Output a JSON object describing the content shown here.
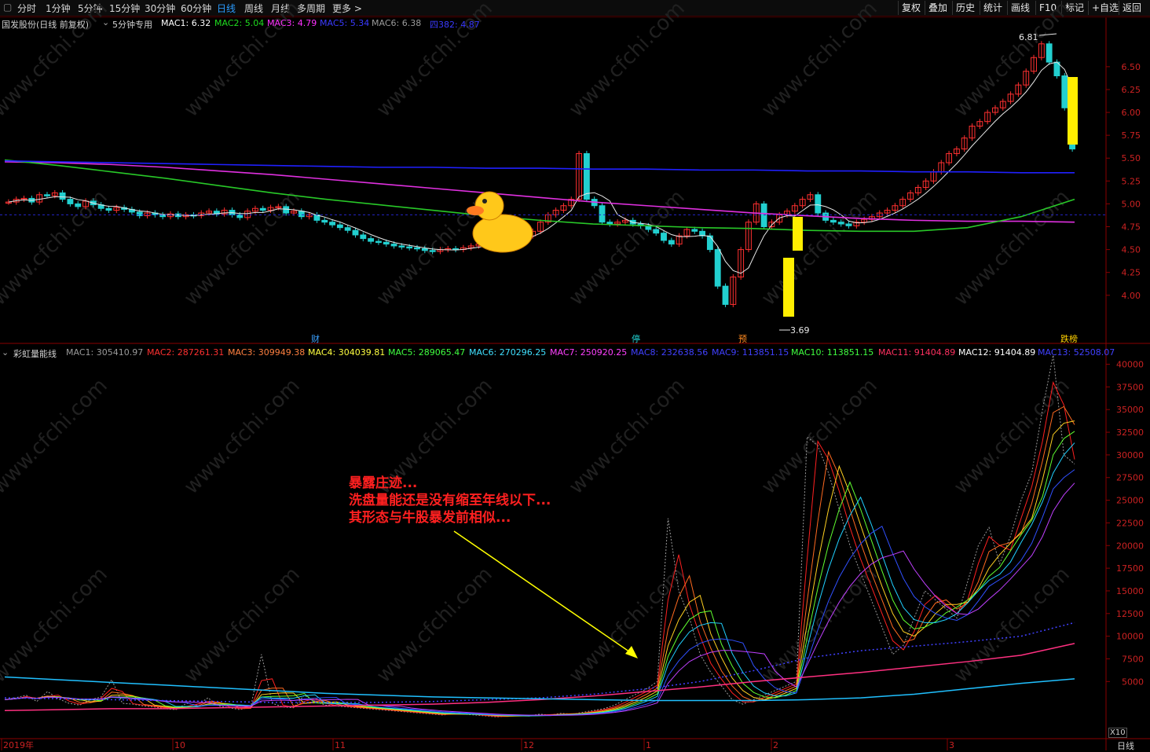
{
  "toolbar": {
    "tabs": [
      "分时",
      "1分钟",
      "5分钟",
      "15分钟",
      "30分钟",
      "60分钟",
      "日线",
      "周线",
      "月线",
      "多周期",
      "更多 >"
    ],
    "active_tab": "日线",
    "right_buttons": [
      "复权",
      "叠加",
      "历史",
      "统计",
      "画线",
      "F10",
      "标记",
      "+自选",
      "返回"
    ]
  },
  "price_panel": {
    "title": "国发股份(日线 前复权)",
    "indicator": "5分钟专用",
    "legend": [
      {
        "label": "MAC1: 6.32",
        "color": "#ffffff"
      },
      {
        "label": "MAC2: 5.04",
        "color": "#1fdc1f"
      },
      {
        "label": "MAC3: 4.79",
        "color": "#ff30ff"
      },
      {
        "label": "MAC5: 5.34",
        "color": "#3a3aff"
      },
      {
        "label": "MAC6: 6.38",
        "color": "#9a9a9a"
      },
      {
        "label": "四382: 4.87",
        "color": "#3a3aff"
      }
    ],
    "high_label": "6.81",
    "low_label": "3.69",
    "markers": [
      {
        "text": "财",
        "color": "#3aa0ff"
      },
      {
        "text": "停",
        "color": "#22d4d4"
      },
      {
        "text": "预",
        "color": "#ff8a20"
      },
      {
        "text": "跌榜",
        "color": "#ffd000"
      }
    ]
  },
  "volume_panel": {
    "title": "彩虹量能线",
    "legend": [
      {
        "label": "MAC1: 305410.97",
        "color": "#9a9a9a"
      },
      {
        "label": "MAC2: 287261.31",
        "color": "#ff3030"
      },
      {
        "label": "MAC3: 309949.38",
        "color": "#ff8040"
      },
      {
        "label": "MAC4: 304039.81",
        "color": "#ffff40"
      },
      {
        "label": "MAC5: 289065.47",
        "color": "#40ff40"
      },
      {
        "label": "MAC6: 270296.25",
        "color": "#40e0ff"
      },
      {
        "label": "MAC7: 250920.25",
        "color": "#ff40ff"
      },
      {
        "label": "MAC8: 232638.56",
        "color": "#4040ff"
      },
      {
        "label": "MAC9: 113851.15",
        "color": "#4040ff"
      },
      {
        "label": "MAC10: 113851.15",
        "color": "#40ff40"
      },
      {
        "label": "MAC11: 91404.89",
        "color": "#ff3060"
      },
      {
        "label": "MAC12: 91404.89",
        "color": "#ffffff"
      },
      {
        "label": "MAC13: 52508.07",
        "color": "#4040ff"
      }
    ],
    "multiplier": "X10"
  },
  "annotation": {
    "lines": [
      "暴露庄迹...",
      "洗盘量能还是没有缩至年线以下...",
      "其形态与牛股暴发前相似..."
    ],
    "color": "#ff2020",
    "arrow_color": "#ffff00"
  },
  "watermark": "www.cfchi.com",
  "period_label": "日线",
  "chart_data": [
    {
      "type": "line",
      "title": "国发股份(日线 前复权)",
      "y_ticks": [
        "6.50",
        "6.25",
        "6.00",
        "5.75",
        "5.50",
        "5.25",
        "5.00",
        "4.75",
        "4.50",
        "4.25",
        "4.00"
      ],
      "ylim": [
        3.62,
        6.92
      ],
      "x_labels": [
        "2019年",
        "10",
        "11",
        "12",
        "1",
        "2",
        "3"
      ],
      "close": [
        5.02,
        5.05,
        5.06,
        5.02,
        5.1,
        5.09,
        5.12,
        5.05,
        5.0,
        4.97,
        5.03,
        4.99,
        4.95,
        4.93,
        4.96,
        4.94,
        4.91,
        4.87,
        4.9,
        4.88,
        4.86,
        4.89,
        4.86,
        4.88,
        4.87,
        4.9,
        4.92,
        4.89,
        4.93,
        4.88,
        4.85,
        4.92,
        4.95,
        4.93,
        4.96,
        4.97,
        4.9,
        4.92,
        4.86,
        4.88,
        4.82,
        4.8,
        4.77,
        4.74,
        4.71,
        4.66,
        4.62,
        4.59,
        4.58,
        4.56,
        4.54,
        4.53,
        4.52,
        4.51,
        4.49,
        4.48,
        4.5,
        4.51,
        4.5,
        4.52,
        4.54,
        4.56,
        4.58,
        4.6,
        4.61,
        4.63,
        4.62,
        4.65,
        4.7,
        4.8,
        4.88,
        4.93,
        4.98,
        5.05,
        5.55,
        5.05,
        4.98,
        4.8,
        4.78,
        4.8,
        4.82,
        4.78,
        4.76,
        4.72,
        4.68,
        4.6,
        4.56,
        4.65,
        4.72,
        4.7,
        4.65,
        4.5,
        4.1,
        3.9,
        4.2,
        4.5,
        4.8,
        5.0,
        4.75,
        4.8,
        4.88,
        4.92,
        4.98,
        5.05,
        5.1,
        4.9,
        4.82,
        4.8,
        4.78,
        4.76,
        4.8,
        4.83,
        4.86,
        4.9,
        4.93,
        4.98,
        5.05,
        5.12,
        5.18,
        5.25,
        5.35,
        5.45,
        5.55,
        5.6,
        5.72,
        5.85,
        5.9,
        6.0,
        6.05,
        6.12,
        6.2,
        6.3,
        6.45,
        6.6,
        6.75,
        6.55,
        6.4,
        6.05,
        5.6
      ],
      "ma_lines": [
        {
          "name": "MAC3",
          "values": [
            5.46,
            5.45,
            5.43,
            5.4,
            5.36,
            5.32,
            5.27,
            5.22,
            5.17,
            5.12,
            5.07,
            5.02,
            4.98,
            4.94,
            4.9,
            4.87,
            4.84,
            4.82,
            4.81,
            4.81,
            4.8
          ],
          "color": "#e030e0"
        },
        {
          "name": "MAC2",
          "values": [
            5.48,
            5.42,
            5.35,
            5.28,
            5.2,
            5.12,
            5.05,
            4.99,
            4.93,
            4.87,
            4.82,
            4.78,
            4.76,
            4.74,
            4.73,
            4.71,
            4.7,
            4.7,
            4.74,
            4.86,
            5.05
          ],
          "color": "#28c828"
        },
        {
          "name": "MAC5",
          "values": [
            5.47,
            5.46,
            5.45,
            5.44,
            5.43,
            5.42,
            5.41,
            5.4,
            5.4,
            5.39,
            5.39,
            5.38,
            5.38,
            5.37,
            5.37,
            5.36,
            5.36,
            5.35,
            5.35,
            5.34,
            5.34
          ],
          "color": "#2020ff"
        }
      ]
    },
    {
      "type": "line",
      "title": "彩虹量能线",
      "y_ticks": [
        "40000",
        "37500",
        "35000",
        "32500",
        "30000",
        "27500",
        "25000",
        "22500",
        "20000",
        "17500",
        "15000",
        "12500",
        "10000",
        "7500",
        "5000"
      ],
      "ylim": [
        0,
        41000
      ],
      "volume": [
        3000,
        3200,
        3500,
        2800,
        3900,
        3100,
        2600,
        2400,
        3000,
        3300,
        5200,
        2600,
        2500,
        2300,
        2200,
        2000,
        1900,
        2600,
        2400,
        3200,
        2300,
        2100,
        1900,
        2200,
        8000,
        2600,
        2200,
        2100,
        3500,
        2800,
        2400,
        2300,
        2200,
        2100,
        2000,
        1900,
        1800,
        1700,
        1600,
        1500,
        1400,
        1300,
        1500,
        1400,
        1300,
        1200,
        1100,
        1200,
        1300,
        1200,
        1400,
        1300,
        1500,
        1400,
        1600,
        1800,
        2000,
        2400,
        3000,
        3600,
        4200,
        5000,
        23000,
        15000,
        12000,
        8000,
        6000,
        4500,
        3000,
        2500,
        3000,
        3500,
        4000,
        4500,
        5000,
        32000,
        31000,
        28000,
        24000,
        20000,
        17000,
        14000,
        11000,
        8000,
        9000,
        12000,
        15000,
        14000,
        13000,
        12000,
        16000,
        20000,
        22000,
        18000,
        21000,
        25000,
        28000,
        35000,
        41000,
        30000,
        29000
      ],
      "ma_lines": [
        {
          "name": "MAC11",
          "values": [
            1800,
            1900,
            2000,
            2000,
            2100,
            2200,
            2300,
            2400,
            2500,
            2700,
            3000,
            3400,
            3900,
            4400,
            5000,
            5500,
            6000,
            6600,
            7200,
            7900,
            9200
          ],
          "color": "#ff3080"
        },
        {
          "name": "MAC9",
          "values": [
            3200,
            3100,
            3000,
            2900,
            2800,
            2700,
            2700,
            2700,
            2800,
            3000,
            3200,
            3600,
            4200,
            5000,
            6200,
            7600,
            8400,
            8900,
            9400,
            10000,
            11500
          ],
          "color": "#4040ff"
        },
        {
          "name": "MAC13",
          "values": [
            5500,
            5200,
            4900,
            4600,
            4300,
            4000,
            3700,
            3500,
            3300,
            3200,
            3100,
            3000,
            2900,
            2900,
            2900,
            3000,
            3200,
            3600,
            4200,
            4800,
            5300
          ],
          "color": "#20c0ff"
        }
      ]
    }
  ]
}
